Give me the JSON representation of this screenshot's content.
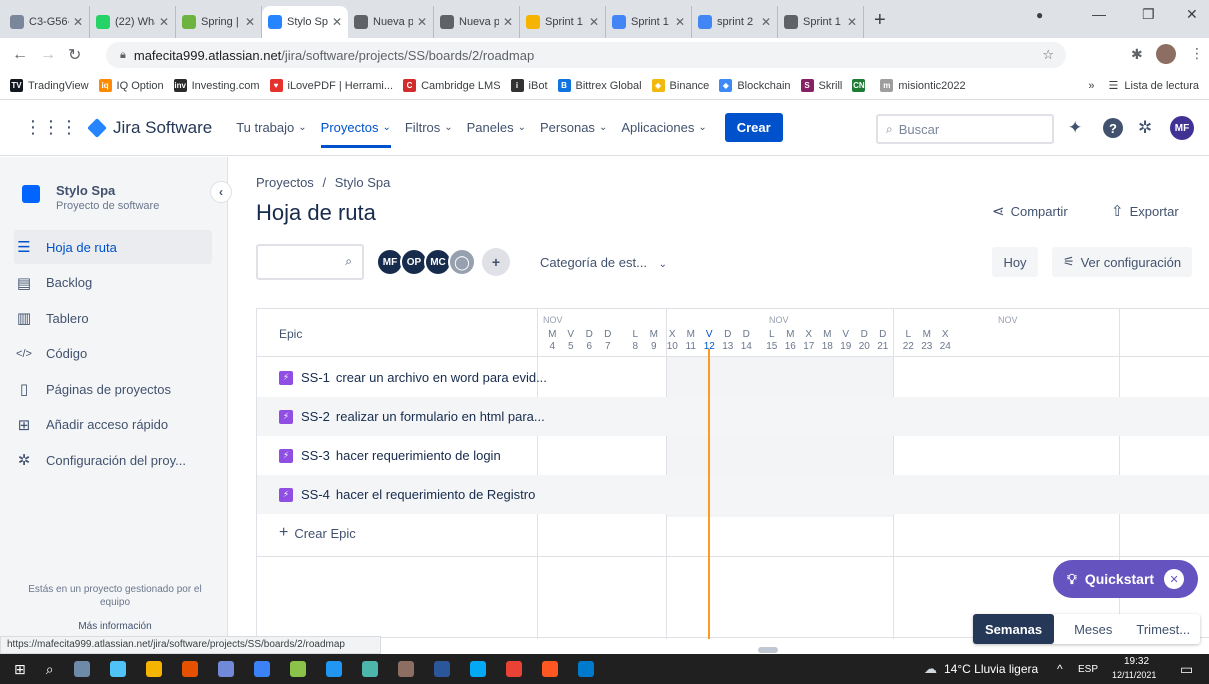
{
  "browser": {
    "tabs": [
      {
        "label": "C3-G56-",
        "color": "#7a869a"
      },
      {
        "label": "(22) Wha",
        "color": "#25d366"
      },
      {
        "label": "Spring |",
        "color": "#6db33f"
      },
      {
        "label": "Stylo Sp",
        "color": "#2684ff"
      },
      {
        "label": "Nueva p",
        "color": "#5f6368"
      },
      {
        "label": "Nueva p",
        "color": "#5f6368"
      },
      {
        "label": "Sprint 1",
        "color": "#f4b400"
      },
      {
        "label": "Sprint 1",
        "color": "#4285f4"
      },
      {
        "label": "sprint 2",
        "color": "#4285f4"
      },
      {
        "label": "Sprint 1",
        "color": "#5f6368"
      }
    ],
    "url_host": "mafecita999.atlassian.net",
    "url_path": "/jira/software/projects/SS/boards/2/roadmap",
    "bookmarks": [
      {
        "label": "TradingView",
        "color": "#131722",
        "glyph": "TV"
      },
      {
        "label": "IQ Option",
        "color": "#ff8a00",
        "glyph": "iq"
      },
      {
        "label": "Investing.com",
        "color": "#2b2b2b",
        "glyph": "inv"
      },
      {
        "label": "iLovePDF | Herrami...",
        "color": "#e5322d",
        "glyph": "♥"
      },
      {
        "label": "Cambridge LMS",
        "color": "#d12b2b",
        "glyph": "C"
      },
      {
        "label": "iBot",
        "color": "#333333",
        "glyph": "i"
      },
      {
        "label": "Bittrex Global",
        "color": "#0f74e0",
        "glyph": "B"
      },
      {
        "label": "Binance",
        "color": "#f0b90b",
        "glyph": "◆"
      },
      {
        "label": "Blockchain",
        "color": "#3d89f5",
        "glyph": "◆"
      },
      {
        "label": "Skrill",
        "color": "#862165",
        "glyph": "S"
      },
      {
        "label": "",
        "color": "#1e7b34",
        "glyph": "CN"
      },
      {
        "label": "misiontic2022",
        "color": "#9e9e9e",
        "glyph": "m"
      }
    ],
    "reading_list": "Lista de lectura",
    "status_url": "https://mafecita999.atlassian.net/jira/software/projects/SS/boards/2/roadmap"
  },
  "jira": {
    "product": "Jira Software",
    "nav": [
      "Tu trabajo",
      "Proyectos",
      "Filtros",
      "Paneles",
      "Personas",
      "Aplicaciones"
    ],
    "create": "Crear",
    "search_placeholder": "Buscar",
    "user_initials": "MF"
  },
  "sidebar": {
    "project_name": "Stylo Spa",
    "project_type": "Proyecto de software",
    "items": [
      {
        "label": "Hoja de ruta",
        "icon": "roadmap-icon"
      },
      {
        "label": "Backlog",
        "icon": "backlog-icon"
      },
      {
        "label": "Tablero",
        "icon": "board-icon"
      },
      {
        "label": "Código",
        "icon": "code-icon"
      },
      {
        "label": "Páginas de proyectos",
        "icon": "pages-icon"
      },
      {
        "label": "Añadir acceso rápido",
        "icon": "add-shortcut-icon"
      },
      {
        "label": "Configuración del proy...",
        "icon": "gear-icon"
      }
    ],
    "footer_text": "Estás en un proyecto gestionado por el equipo",
    "footer_link": "Más información"
  },
  "main": {
    "breadcrumb_root": "Proyectos",
    "breadcrumb_sep": "/",
    "breadcrumb_project": "Stylo Spa",
    "title": "Hoja de ruta",
    "share": "Compartir",
    "export": "Exportar",
    "avatars": [
      {
        "initials": "MF",
        "color": "#172b4d"
      },
      {
        "initials": "OP",
        "color": "#172b4d"
      },
      {
        "initials": "MC",
        "color": "#172b4d"
      }
    ],
    "category_filter": "Categoría de est...",
    "today": "Hoy",
    "view_settings": "Ver configuración",
    "epic_header": "Epic",
    "epics": [
      {
        "key": "SS-1",
        "summary": "crear un archivo en word para evid..."
      },
      {
        "key": "SS-2",
        "summary": "realizar un formulario en html para..."
      },
      {
        "key": "SS-3",
        "summary": "hacer requerimiento de login"
      },
      {
        "key": "SS-4",
        "summary": "hacer el requerimiento de Registro"
      }
    ],
    "create_epic": "Crear Epic",
    "month_label": "NOV",
    "days": [
      {
        "l": "M",
        "n": "4"
      },
      {
        "l": "V",
        "n": "5"
      },
      {
        "l": "D",
        "n": "6"
      },
      {
        "l": "D",
        "n": "7"
      },
      {
        "l": "L",
        "n": "8"
      },
      {
        "l": "M",
        "n": "9"
      },
      {
        "l": "X",
        "n": "10"
      },
      {
        "l": "M",
        "n": "11"
      },
      {
        "l": "V",
        "n": "12"
      },
      {
        "l": "D",
        "n": "13"
      },
      {
        "l": "D",
        "n": "14"
      },
      {
        "l": "L",
        "n": "15"
      },
      {
        "l": "M",
        "n": "16"
      },
      {
        "l": "X",
        "n": "17"
      },
      {
        "l": "M",
        "n": "18"
      },
      {
        "l": "V",
        "n": "19"
      },
      {
        "l": "D",
        "n": "20"
      },
      {
        "l": "D",
        "n": "21"
      },
      {
        "l": "L",
        "n": "22"
      },
      {
        "l": "M",
        "n": "23"
      },
      {
        "l": "X",
        "n": "24"
      }
    ],
    "today_day": "12",
    "quickstart": "Quickstart",
    "zoom": [
      "Semanas",
      "Meses",
      "Trimest..."
    ],
    "zoom_selected": "Semanas"
  },
  "taskbar": {
    "weather": "14°C Lluvia ligera",
    "lang": "ESP",
    "time": "19:32",
    "date": "12/11/2021"
  },
  "colors": {
    "jira_blue": "#0052cc",
    "today_line": "#ff991f",
    "epic_purple": "#904ee2",
    "quickstart": "#6554c0"
  }
}
